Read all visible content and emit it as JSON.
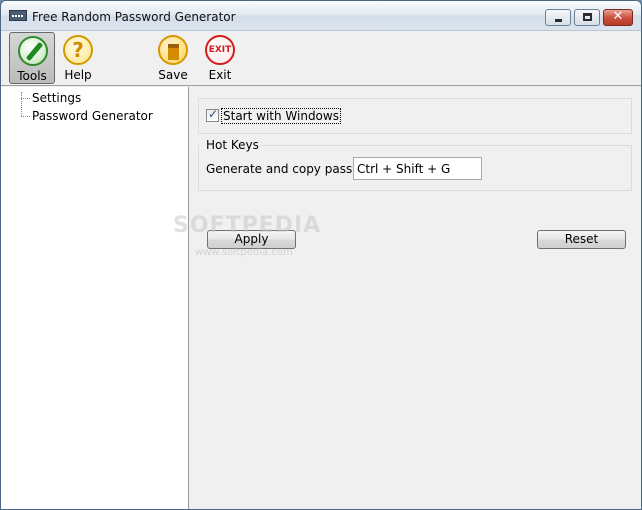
{
  "window": {
    "title": "Free Random Password Generator"
  },
  "toolbar": {
    "items": [
      {
        "label": "Tools",
        "icon": "tools-icon"
      },
      {
        "label": "Help",
        "icon": "help-icon",
        "glyph": "?"
      },
      {
        "label": "Save",
        "icon": "save-icon"
      },
      {
        "label": "Exit",
        "icon": "exit-icon",
        "glyph": "EXIT"
      }
    ]
  },
  "tree": {
    "items": [
      {
        "label": "Settings"
      },
      {
        "label": "Password Generator"
      }
    ]
  },
  "settings": {
    "start_with_windows": {
      "label": "Start with Windows",
      "checked": true
    },
    "hot_keys": {
      "title": "Hot Keys",
      "generate_label": "Generate and copy password",
      "generate_value": "Ctrl + Shift + G"
    },
    "apply_label": "Apply",
    "reset_label": "Reset"
  },
  "watermark": {
    "text": "SOFTPEDIA",
    "sub": "www.softpedia.com"
  },
  "colors": {
    "exit_red": "#d21c1c",
    "tools_green": "#2e8a2e",
    "help_yellow": "#d19a00"
  }
}
